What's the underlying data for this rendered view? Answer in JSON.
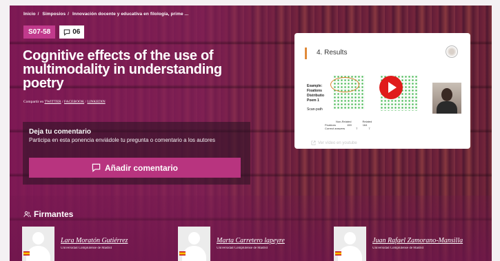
{
  "breadcrumb": [
    "Inicio",
    "Simposios",
    "Innovación docente y educativa en filología, prime ..."
  ],
  "tags": {
    "code": "S07-58",
    "comments_count": "06"
  },
  "title": "Cognitive effects of the use of multimodality in understanding poetry",
  "share": {
    "label": "Compartir en",
    "links": [
      "TWITTER",
      "FACEBOOK",
      "LINKEDIN"
    ]
  },
  "comment": {
    "heading": "Deja tu comentario",
    "subtext": "Participa en esta ponencia enviádole tu pregunta o comentario a los autores",
    "button_label": "Añadir comentario"
  },
  "video": {
    "slide_title": "4. Results",
    "example_lines": [
      "Example:",
      "Fixations",
      "Distributio",
      "Poem 1"
    ],
    "scan_path": "Scan-path",
    "table": {
      "headers": [
        "",
        "Non-Related",
        "Related"
      ],
      "rows": [
        [
          "Fixations",
          "159",
          "164"
        ],
        [
          "Correct answers",
          "7",
          "7"
        ]
      ]
    },
    "youtube_link": "Ver vídeo en youtube"
  },
  "signers_heading": "Firmantes",
  "signers": [
    {
      "name": "Lara Moratón Gutiérrez",
      "affiliation": "Universidad Complutense de Madrid"
    },
    {
      "name": "Marta Carretero lapeyre",
      "affiliation": "Universidad Complutense de Madrid"
    },
    {
      "name": "Juan Rafael Zamorano-Mansilla",
      "affiliation": "Universidad Complutense de Madrid"
    }
  ],
  "colors": {
    "accent": "#b8347f",
    "tag": "#c13a8c",
    "play": "#e01b1b"
  }
}
